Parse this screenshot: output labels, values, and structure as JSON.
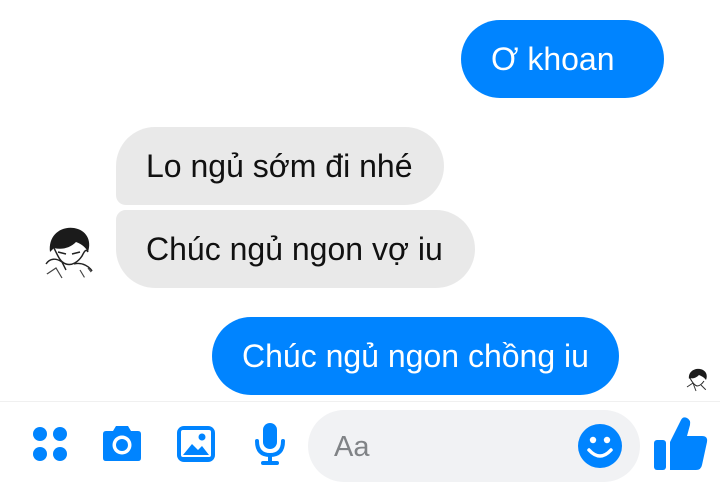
{
  "messages": [
    {
      "id": "m1",
      "direction": "outgoing",
      "text": "Ơ khoan"
    },
    {
      "id": "m2",
      "direction": "incoming",
      "text": "Lo ngủ sớm đi nhé"
    },
    {
      "id": "m3",
      "direction": "incoming",
      "text": "Chúc ngủ ngon vợ iu"
    },
    {
      "id": "m4",
      "direction": "outgoing",
      "text": "Chúc ngủ ngon chồng iu"
    }
  ],
  "composer": {
    "placeholder": "Aa",
    "icons": [
      "apps-icon",
      "camera-icon",
      "image-icon",
      "microphone-icon",
      "emoji-icon",
      "thumbs-up-icon"
    ]
  },
  "colors": {
    "accent": "#0084ff",
    "incoming_bubble": "#e9e9e9",
    "input_background": "#f1f2f4"
  }
}
